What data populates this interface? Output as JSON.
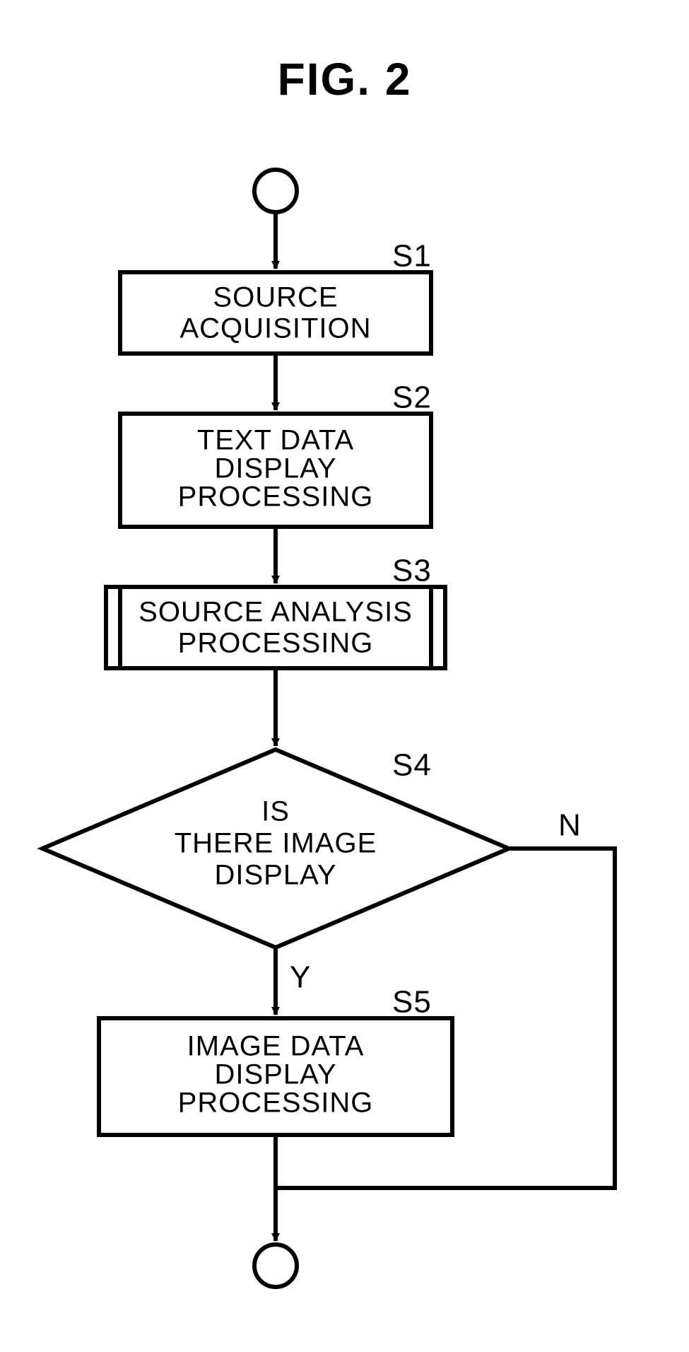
{
  "title": "FIG. 2",
  "steps": {
    "s1": {
      "label": "S1",
      "line1": "SOURCE",
      "line2": "ACQUISITION"
    },
    "s2": {
      "label": "S2",
      "line1": "TEXT DATA",
      "line2": "DISPLAY",
      "line3": "PROCESSING"
    },
    "s3": {
      "label": "S3",
      "line1": "SOURCE ANALYSIS",
      "line2": "PROCESSING"
    },
    "s4": {
      "label": "S4",
      "line1": "IS",
      "line2": "THERE IMAGE",
      "line3": "DISPLAY"
    },
    "s5": {
      "label": "S5",
      "line1": "IMAGE DATA",
      "line2": "DISPLAY",
      "line3": "PROCESSING"
    }
  },
  "branches": {
    "yes": "Y",
    "no": "N"
  },
  "chart_data": {
    "type": "flowchart",
    "title": "FIG. 2",
    "nodes": [
      {
        "id": "start",
        "type": "terminator",
        "label": ""
      },
      {
        "id": "S1",
        "type": "process",
        "label": "SOURCE ACQUISITION"
      },
      {
        "id": "S2",
        "type": "process",
        "label": "TEXT DATA DISPLAY PROCESSING"
      },
      {
        "id": "S3",
        "type": "predefined-process",
        "label": "SOURCE ANALYSIS PROCESSING"
      },
      {
        "id": "S4",
        "type": "decision",
        "label": "IS THERE IMAGE DISPLAY"
      },
      {
        "id": "S5",
        "type": "process",
        "label": "IMAGE DATA DISPLAY PROCESSING"
      },
      {
        "id": "end",
        "type": "terminator",
        "label": ""
      }
    ],
    "edges": [
      {
        "from": "start",
        "to": "S1"
      },
      {
        "from": "S1",
        "to": "S2"
      },
      {
        "from": "S2",
        "to": "S3"
      },
      {
        "from": "S3",
        "to": "S4"
      },
      {
        "from": "S4",
        "to": "S5",
        "label": "Y"
      },
      {
        "from": "S4",
        "to": "end",
        "label": "N"
      },
      {
        "from": "S5",
        "to": "end"
      }
    ]
  }
}
